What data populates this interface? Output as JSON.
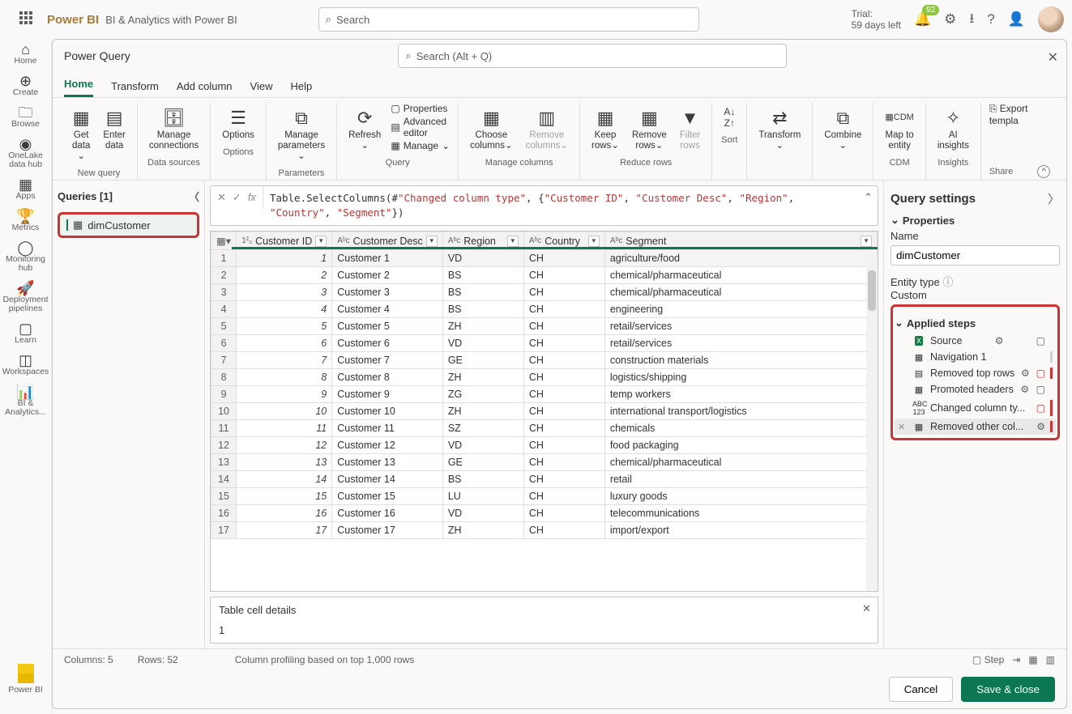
{
  "top": {
    "brand": "Power BI",
    "subtitle": "BI & Analytics with Power BI",
    "searchPlaceholder": "Search",
    "trial_line1": "Trial:",
    "trial_line2": "59 days left",
    "notif_count": "92"
  },
  "rail": {
    "home": "Home",
    "create": "Create",
    "browse": "Browse",
    "onelake": "OneLake data hub",
    "apps": "Apps",
    "metrics": "Metrics",
    "monitoring": "Monitoring hub",
    "pipelines": "Deployment pipelines",
    "learn": "Learn",
    "workspaces": "Workspaces",
    "biana": "BI & Analytics...",
    "powerbi": "Power BI"
  },
  "pq": {
    "title": "Power Query",
    "searchPlaceholder": "Search (Alt + Q)",
    "tabs": {
      "home": "Home",
      "transform": "Transform",
      "addcolumn": "Add column",
      "view": "View",
      "help": "Help"
    },
    "ribbon": {
      "getdata": "Get data",
      "enterdata": "Enter data",
      "newquery": "New query",
      "manageconn": "Manage connections",
      "datasources": "Data sources",
      "options": "Options",
      "optionsgrp": "Options",
      "manageparam": "Manage parameters",
      "parameters": "Parameters",
      "refresh": "Refresh",
      "properties": "Properties",
      "adveditor": "Advanced editor",
      "manage": "Manage",
      "querygrp": "Query",
      "choosecol": "Choose columns",
      "removecol": "Remove columns",
      "managecols": "Manage columns",
      "keeprows": "Keep rows",
      "removerows": "Remove rows",
      "filterrows": "Filter rows",
      "reducerows": "Reduce rows",
      "sort": "Sort",
      "transform": "Transform",
      "combine": "Combine",
      "maptoentity": "Map to entity",
      "cdm": "CDM",
      "aiinsights": "AI insights",
      "insights": "Insights",
      "export": "Export templa",
      "share": "Share"
    },
    "queries": {
      "head": "Queries [1]",
      "item1": "dimCustomer"
    },
    "formula_pre": "Table.SelectColumns(#",
    "formula_str1": "\"Changed column type\"",
    "formula_mid1": ", {",
    "formula_str2": "\"Customer ID\"",
    "formula_mid2": ", ",
    "formula_str3": "\"Customer Desc\"",
    "formula_mid3": ", ",
    "formula_str4": "\"Region\"",
    "formula_mid4": ", ",
    "formula_str5": "\"Country\"",
    "formula_mid5": ", ",
    "formula_str6": "\"Segment\"",
    "formula_end": "})",
    "cols": {
      "id": "Customer ID",
      "desc": "Customer Desc",
      "region": "Region",
      "country": "Country",
      "segment": "Segment"
    },
    "rows": [
      {
        "n": "1",
        "id": "1",
        "desc": "Customer 1",
        "region": "VD",
        "country": "CH",
        "segment": "agriculture/food"
      },
      {
        "n": "2",
        "id": "2",
        "desc": "Customer 2",
        "region": "BS",
        "country": "CH",
        "segment": "chemical/pharmaceutical"
      },
      {
        "n": "3",
        "id": "3",
        "desc": "Customer 3",
        "region": "BS",
        "country": "CH",
        "segment": "chemical/pharmaceutical"
      },
      {
        "n": "4",
        "id": "4",
        "desc": "Customer 4",
        "region": "BS",
        "country": "CH",
        "segment": "engineering"
      },
      {
        "n": "5",
        "id": "5",
        "desc": "Customer 5",
        "region": "ZH",
        "country": "CH",
        "segment": "retail/services"
      },
      {
        "n": "6",
        "id": "6",
        "desc": "Customer 6",
        "region": "VD",
        "country": "CH",
        "segment": "retail/services"
      },
      {
        "n": "7",
        "id": "7",
        "desc": "Customer 7",
        "region": "GE",
        "country": "CH",
        "segment": "construction materials"
      },
      {
        "n": "8",
        "id": "8",
        "desc": "Customer 8",
        "region": "ZH",
        "country": "CH",
        "segment": "logistics/shipping"
      },
      {
        "n": "9",
        "id": "9",
        "desc": "Customer 9",
        "region": "ZG",
        "country": "CH",
        "segment": "temp workers"
      },
      {
        "n": "10",
        "id": "10",
        "desc": "Customer 10",
        "region": "ZH",
        "country": "CH",
        "segment": "international transport/logistics"
      },
      {
        "n": "11",
        "id": "11",
        "desc": "Customer 11",
        "region": "SZ",
        "country": "CH",
        "segment": "chemicals"
      },
      {
        "n": "12",
        "id": "12",
        "desc": "Customer 12",
        "region": "VD",
        "country": "CH",
        "segment": "food packaging"
      },
      {
        "n": "13",
        "id": "13",
        "desc": "Customer 13",
        "region": "GE",
        "country": "CH",
        "segment": "chemical/pharmaceutical"
      },
      {
        "n": "14",
        "id": "14",
        "desc": "Customer 14",
        "region": "BS",
        "country": "CH",
        "segment": "retail"
      },
      {
        "n": "15",
        "id": "15",
        "desc": "Customer 15",
        "region": "LU",
        "country": "CH",
        "segment": "luxury goods"
      },
      {
        "n": "16",
        "id": "16",
        "desc": "Customer 16",
        "region": "VD",
        "country": "CH",
        "segment": "telecommunications"
      },
      {
        "n": "17",
        "id": "17",
        "desc": "Customer 17",
        "region": "ZH",
        "country": "CH",
        "segment": "import/export"
      }
    ],
    "details_title": "Table cell details",
    "details_value": "1",
    "settings": {
      "title": "Query settings",
      "properties": "Properties",
      "name_label": "Name",
      "name_value": "dimCustomer",
      "entity_label": "Entity type",
      "entity_value": "Custom",
      "applied": "Applied steps",
      "steps": {
        "source": "Source",
        "nav": "Navigation 1",
        "removedtop": "Removed top rows",
        "promoted": "Promoted headers",
        "changedtype": "Changed column ty...",
        "removedother": "Removed other col..."
      }
    },
    "status": {
      "cols": "Columns: 5",
      "rows": "Rows: 52",
      "profiling": "Column profiling based on top 1,000 rows",
      "step": "Step"
    },
    "footer": {
      "cancel": "Cancel",
      "save": "Save & close"
    }
  }
}
